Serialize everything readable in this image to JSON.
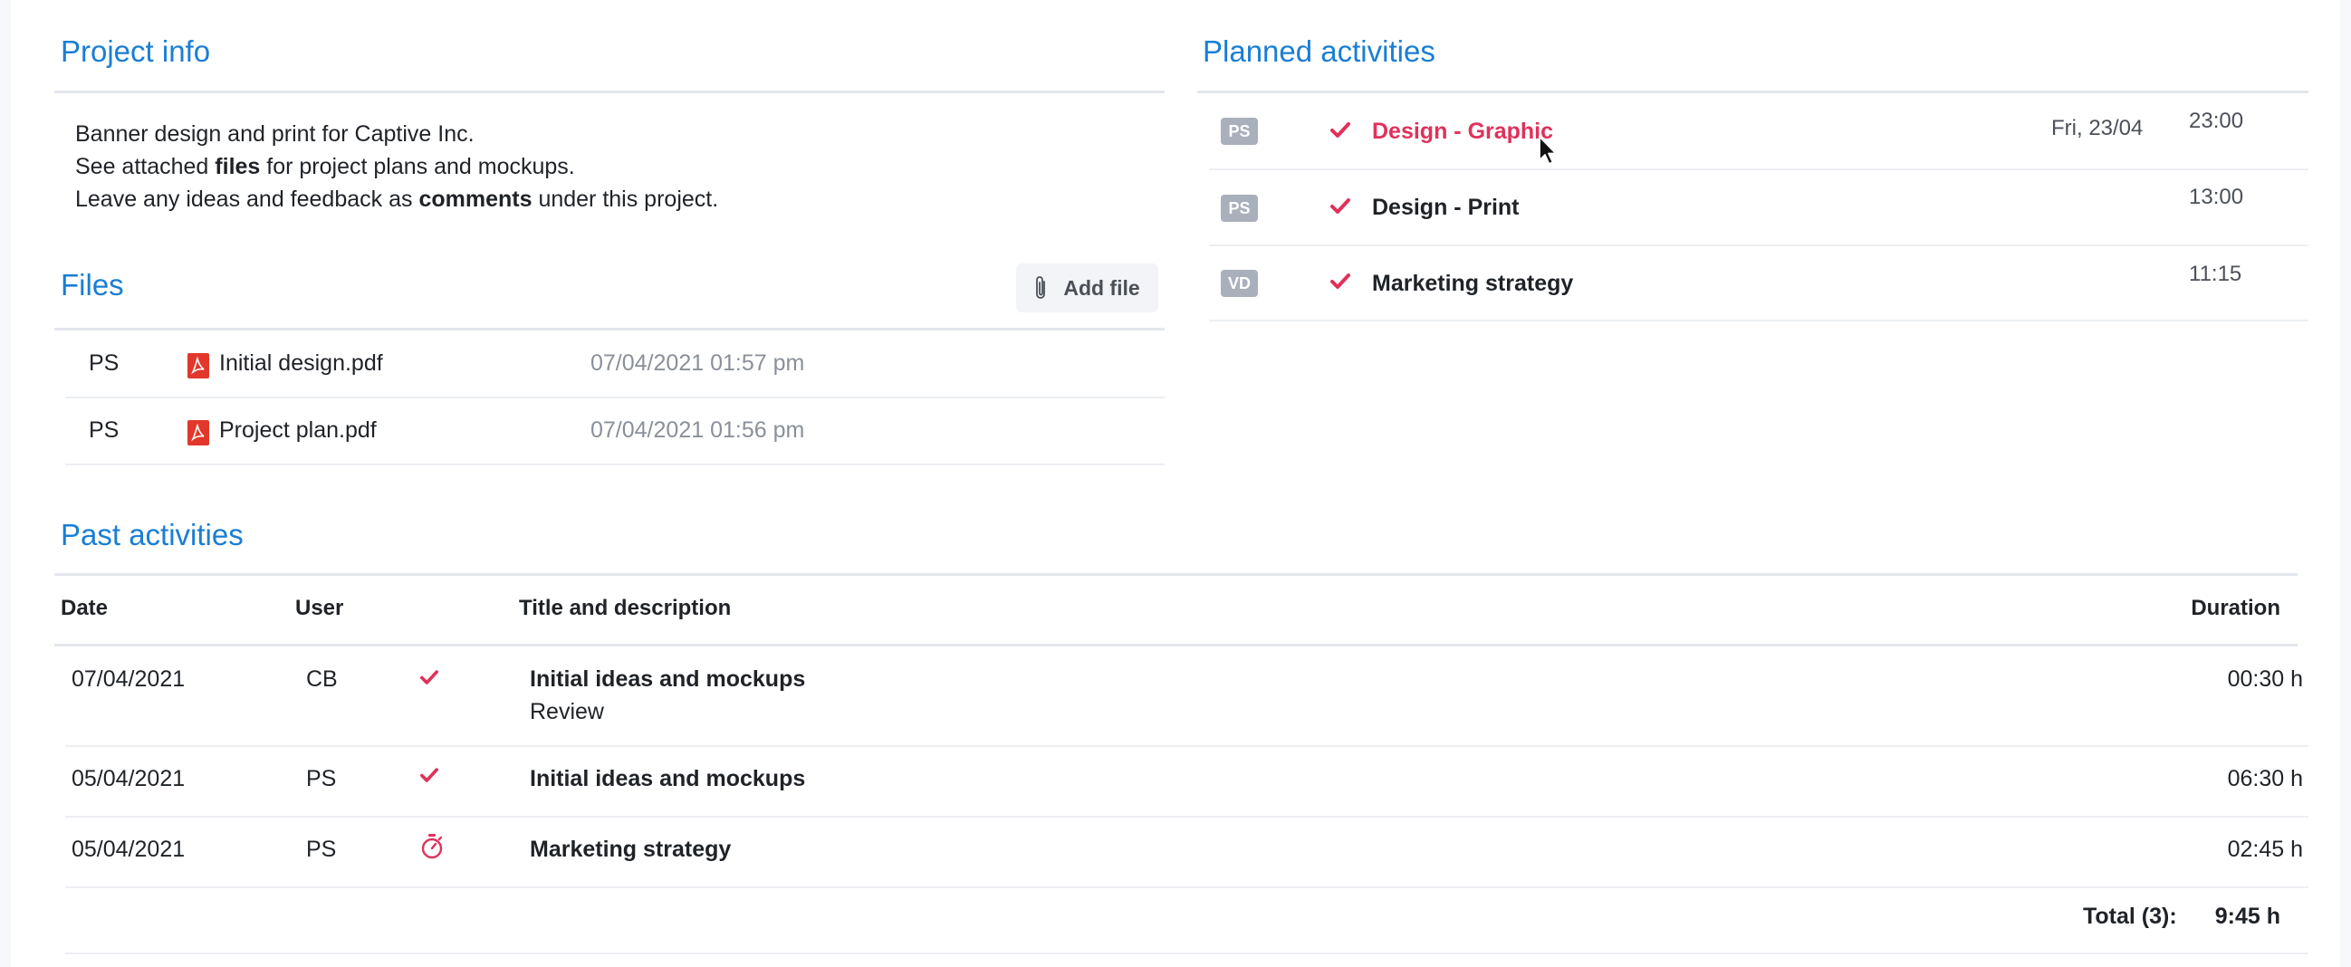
{
  "project_info": {
    "title": "Project info",
    "line1": "Banner design and print for Captive Inc.",
    "line2_before": "See attached ",
    "line2_bold": "files",
    "line2_after": " for project plans and mockups.",
    "line3_before": "Leave any ideas and feedback as ",
    "line3_bold": "comments",
    "line3_after": " under this project."
  },
  "files": {
    "title": "Files",
    "add_label": "Add file",
    "rows": [
      {
        "user": "PS",
        "name": "Initial design.pdf",
        "date": "07/04/2021 01:57 pm"
      },
      {
        "user": "PS",
        "name": "Project plan.pdf",
        "date": "07/04/2021 01:56 pm"
      }
    ]
  },
  "planned": {
    "title": "Planned activities",
    "rows": [
      {
        "user": "PS",
        "title": "Design - Graphic",
        "date": "Fri, 23/04",
        "time": "23:00",
        "hovered": true
      },
      {
        "user": "PS",
        "title": "Design - Print",
        "date": "",
        "time": "13:00"
      },
      {
        "user": "VD",
        "title": "Marketing strategy",
        "date": "",
        "time": "11:15"
      }
    ]
  },
  "past": {
    "title": "Past activities",
    "headers": {
      "date": "Date",
      "user": "User",
      "title": "Title and description",
      "duration": "Duration"
    },
    "rows": [
      {
        "date": "07/04/2021",
        "user": "CB",
        "icon": "check-icon",
        "title": "Initial ideas and mockups",
        "description": "Review",
        "duration": "00:30 h"
      },
      {
        "date": "05/04/2021",
        "user": "PS",
        "icon": "check-icon",
        "title": "Initial ideas and mockups",
        "description": "",
        "duration": "06:30 h"
      },
      {
        "date": "05/04/2021",
        "user": "PS",
        "icon": "stopwatch-icon",
        "title": "Marketing strategy",
        "description": "",
        "duration": "02:45 h"
      }
    ],
    "total_label": "Total (3):",
    "total_value": "9:45 h"
  },
  "colors": {
    "accent": "#1a7ed4",
    "check": "#e0315b",
    "badge": "#a9b0bb"
  }
}
